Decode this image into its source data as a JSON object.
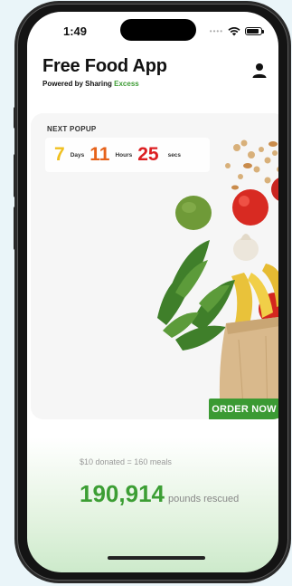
{
  "status_bar": {
    "time": "1:49",
    "icons": [
      "signal-dots-icon",
      "wifi-icon",
      "battery-icon"
    ]
  },
  "header": {
    "title": "Free Food App",
    "subtitle_prefix": "Powered by Sharing ",
    "subtitle_brand": "Excess",
    "profile_icon": "person-icon"
  },
  "popup_card": {
    "label": "NEXT POPUP",
    "countdown": {
      "days_value": "7",
      "days_label": "Days",
      "hours_value": "11",
      "hours_label": "Hours",
      "secs_value": "25",
      "secs_label": "secs"
    },
    "order_button": "ORDER NOW"
  },
  "stats": {
    "donation_note": "$10 donated = 160 meals",
    "pounds_value": "190,914",
    "pounds_label": "pounds rescued"
  },
  "colors": {
    "brand_green": "#3b9a33",
    "days": "#f0c020",
    "hours": "#e6621a",
    "secs": "#dc1f22"
  }
}
